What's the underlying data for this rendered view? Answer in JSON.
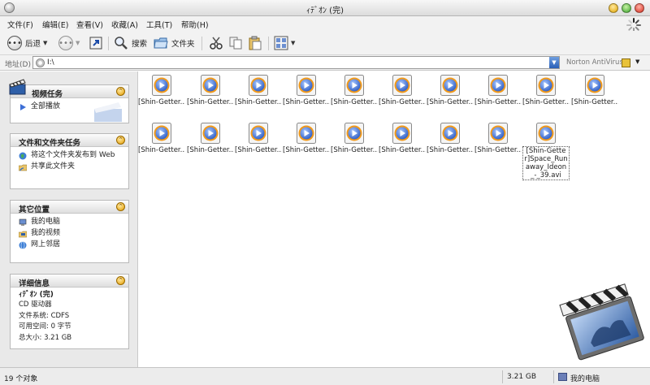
{
  "window": {
    "title": "ｨﾃﾞｵﾝ (完)"
  },
  "menu": [
    {
      "label": "文件(F)"
    },
    {
      "label": "编辑(E)"
    },
    {
      "label": "查看(V)"
    },
    {
      "label": "收藏(A)"
    },
    {
      "label": "工具(T)"
    },
    {
      "label": "帮助(H)"
    }
  ],
  "toolbar": {
    "back_label": "后退",
    "search_label": "搜索",
    "folders_label": "文件夹"
  },
  "address": {
    "label": "地址(D)",
    "value": "I:\\",
    "norton_label": "Norton AntiVirus"
  },
  "sidebar": {
    "video_tasks": {
      "title": "视频任务",
      "items": [
        {
          "label": "全部播放",
          "icon": "play-icon"
        }
      ]
    },
    "file_tasks": {
      "title": "文件和文件夹任务",
      "items": [
        {
          "label": "将这个文件夹发布到 Web",
          "icon": "globe-icon"
        },
        {
          "label": "共享此文件夹",
          "icon": "share-icon"
        }
      ]
    },
    "other_places": {
      "title": "其它位置",
      "items": [
        {
          "label": "我的电脑",
          "icon": "computer-icon"
        },
        {
          "label": "我的视频",
          "icon": "videos-icon"
        },
        {
          "label": "网上邻居",
          "icon": "network-icon"
        }
      ]
    },
    "details": {
      "title": "详细信息",
      "name": "ｨﾃﾞｵﾝ (完)",
      "type": "CD 驱动器",
      "filesystem": "文件系统: CDFS",
      "free": "可用空间: 0 字节",
      "total": "总大小: 3.21 GB"
    }
  },
  "files": [
    {
      "label": "[Shin-Getter..."
    },
    {
      "label": "[Shin-Getter..."
    },
    {
      "label": "[Shin-Getter..."
    },
    {
      "label": "[Shin-Getter..."
    },
    {
      "label": "[Shin-Getter..."
    },
    {
      "label": "[Shin-Getter..."
    },
    {
      "label": "[Shin-Getter..."
    },
    {
      "label": "[Shin-Getter..."
    },
    {
      "label": "[Shin-Getter..."
    },
    {
      "label": "[Shin-Getter..."
    },
    {
      "label": "[Shin-Getter..."
    },
    {
      "label": "[Shin-Getter..."
    },
    {
      "label": "[Shin-Getter..."
    },
    {
      "label": "[Shin-Getter..."
    },
    {
      "label": "[Shin-Getter..."
    },
    {
      "label": "[Shin-Getter..."
    },
    {
      "label": "[Shin-Getter..."
    },
    {
      "label": "[Shin-Getter..."
    },
    {
      "label": "[Shin-Getter]Space_Runaway_Ideon_-_39.avi",
      "selected": true
    }
  ],
  "status": {
    "count": "19 个对象",
    "size": "3.21 GB",
    "location": "我的电脑"
  },
  "colors": {
    "play_blue": "#3d6fd6",
    "play_orange": "#f29a1a",
    "panel_bg": "#e9e9e9"
  }
}
